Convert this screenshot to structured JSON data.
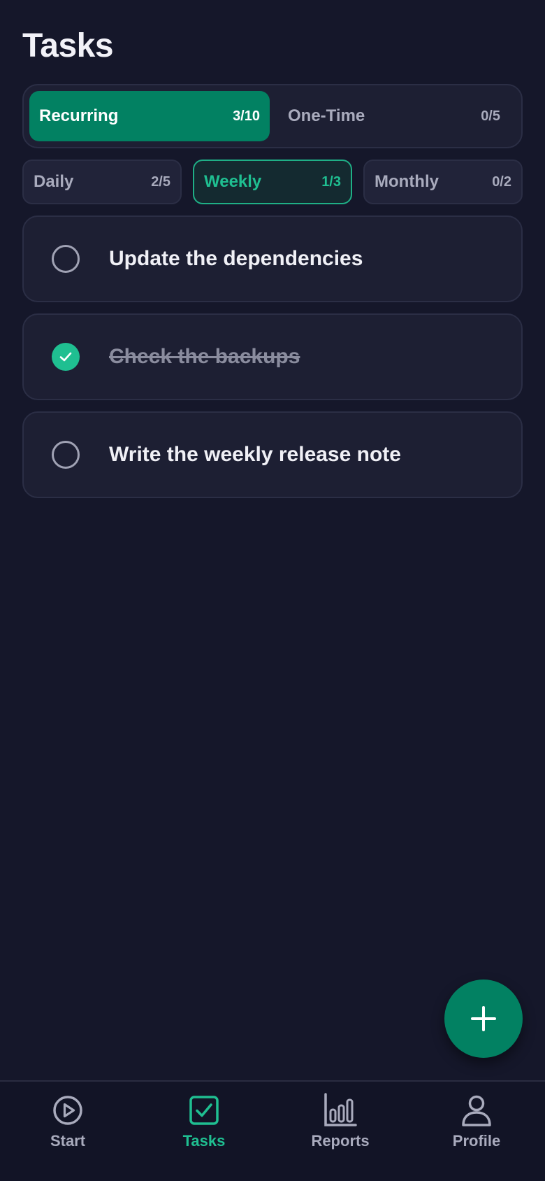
{
  "header": {
    "title": "Tasks"
  },
  "segment": {
    "recurring": {
      "label": "Recurring",
      "count": "3/10"
    },
    "one_time": {
      "label": "One-Time",
      "count": "0/5"
    }
  },
  "filters": {
    "daily": {
      "label": "Daily",
      "count": "2/5"
    },
    "weekly": {
      "label": "Weekly",
      "count": "1/3"
    },
    "monthly": {
      "label": "Monthly",
      "count": "0/2"
    }
  },
  "tasks": [
    {
      "text": "Update the dependencies",
      "done": false
    },
    {
      "text": "Check the backups",
      "done": true
    },
    {
      "text": "Write the weekly release note",
      "done": false
    }
  ],
  "fab": {
    "icon": "plus-icon"
  },
  "nav": {
    "start": {
      "label": "Start",
      "icon": "play-circle-icon"
    },
    "tasks": {
      "label": "Tasks",
      "icon": "checkbox-icon"
    },
    "reports": {
      "label": "Reports",
      "icon": "bar-chart-icon"
    },
    "profile": {
      "label": "Profile",
      "icon": "user-icon"
    }
  },
  "colors": {
    "background": "#15172a",
    "accent": "#028162",
    "accent_text": "#1fbf91",
    "card": "#1d1f33",
    "muted_text": "#a9abbd"
  }
}
